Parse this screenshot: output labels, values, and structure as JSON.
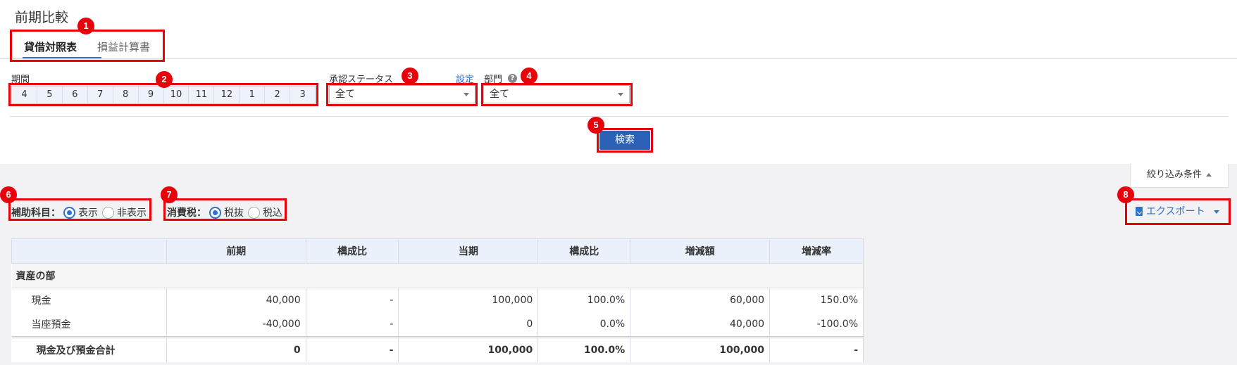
{
  "page": {
    "title": "前期比較"
  },
  "tabs": [
    {
      "label": "貸借対照表",
      "active": true
    },
    {
      "label": "損益計算書",
      "active": false
    }
  ],
  "period": {
    "label": "期間",
    "months": [
      "4",
      "5",
      "6",
      "7",
      "8",
      "9",
      "10",
      "11",
      "12",
      "1",
      "2",
      "3"
    ]
  },
  "approval": {
    "label": "承認ステータス",
    "settings_link": "設定",
    "value": "全て"
  },
  "department": {
    "label": "部門",
    "help_icon": "?",
    "value": "全て"
  },
  "search": {
    "label": "検索"
  },
  "filter_toggle": {
    "label": "絞り込み条件"
  },
  "sub_account": {
    "label": "補助科目：",
    "options": [
      "表示",
      "非表示"
    ],
    "selected": "表示"
  },
  "tax": {
    "label": "消費税：",
    "options": [
      "税抜",
      "税込"
    ],
    "selected": "税抜"
  },
  "export": {
    "label": "エクスポート"
  },
  "table": {
    "headers": [
      "",
      "前期",
      "構成比",
      "当期",
      "構成比",
      "増減額",
      "増減率"
    ],
    "section": "資産の部",
    "rows": [
      {
        "account": "現金",
        "prev": "40,000",
        "prev_ratio": "-",
        "curr": "100,000",
        "curr_ratio": "100.0%",
        "diff": "60,000",
        "rate": "150.0%"
      },
      {
        "account": "当座預金",
        "prev": "-40,000",
        "prev_ratio": "-",
        "curr": "0",
        "curr_ratio": "0.0%",
        "diff": "40,000",
        "rate": "-100.0%"
      }
    ],
    "total": {
      "account": "現金及び預金合計",
      "prev": "0",
      "prev_ratio": "-",
      "curr": "100,000",
      "curr_ratio": "100.0%",
      "diff": "100,000",
      "rate": "-"
    }
  },
  "annotations": [
    "1",
    "2",
    "3",
    "4",
    "5",
    "6",
    "7",
    "8"
  ],
  "colors": {
    "accent": "#2f73c9",
    "primary_button": "#2b62b8",
    "annotation": "#e8000b"
  }
}
